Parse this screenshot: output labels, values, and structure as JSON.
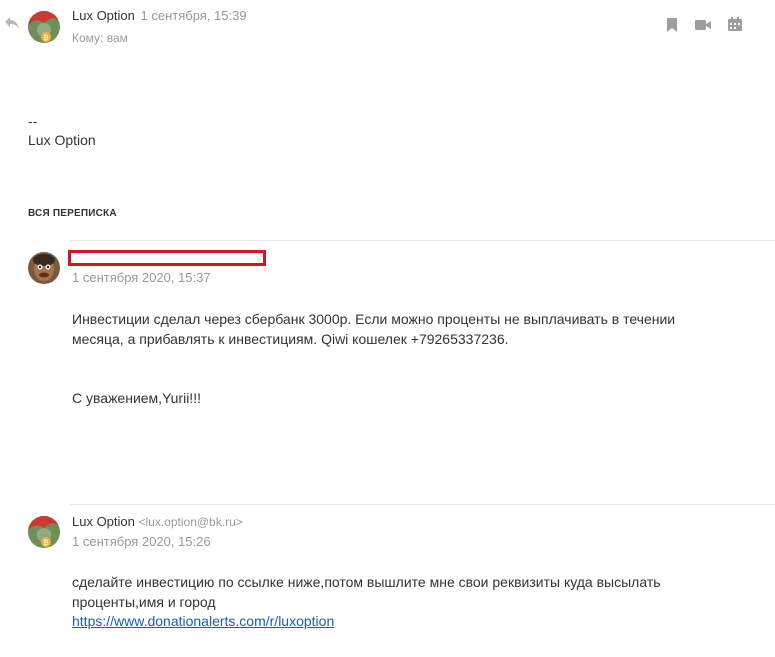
{
  "top_message": {
    "sender": "Lux Option",
    "date": "1 сентября, 15:39",
    "to": "Кому: вам",
    "signature_dash": "--",
    "signature_name": "Lux Option"
  },
  "toolbar": {
    "icons": [
      "reply-icon",
      "bookmark-icon",
      "video-icon",
      "calendar-icon"
    ]
  },
  "thread": {
    "title": "ВСЯ ПЕРЕПИСКА",
    "messages": [
      {
        "sender": "",
        "date": "1 сентября 2020, 15:37",
        "line1": "Инвестиции сделал через сбербанк 3000р. Если можно проценты не выплачивать в течении",
        "line2": "месяца, а прибавлять к инвестициям. Qiwi кошелек +79265337236.",
        "closing": "С уважением,Yurii!!!"
      },
      {
        "sender": "Lux Option",
        "email": "<lux.option@bk.ru>",
        "date": "1 сентября 2020, 15:26",
        "line1": "сделайте инвестицию по ссылке ниже,потом вышлите мне свои реквизиты куда высылать",
        "line2": "проценты,имя и город",
        "link": "https://www.donationalerts.com/r/luxoption"
      }
    ]
  }
}
